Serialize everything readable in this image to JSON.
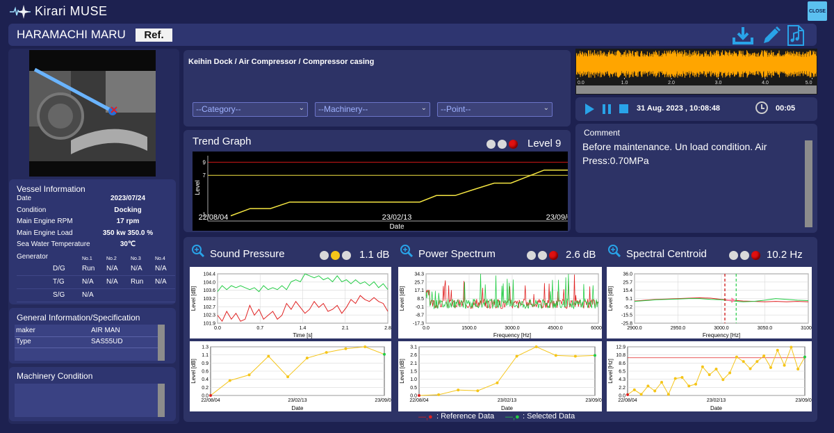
{
  "app": {
    "title": "Kirari MUSE",
    "close_label": "CLOSE"
  },
  "header": {
    "vessel_name": "HARAMACHI MARU",
    "ref_label": "Ref."
  },
  "breadcrumb": "Keihin Dock / Air Compressor / Compressor casing",
  "dropdowns": {
    "category": "--Category--",
    "machinery": "--Machinery--",
    "point": "--Point--"
  },
  "waveform": {
    "ticks": [
      "0.0",
      "1.0",
      "2.0",
      "3.0",
      "4.0",
      "5.0"
    ]
  },
  "player": {
    "datetime": "31 Aug. 2023 , 10:08:48",
    "duration": "00:05"
  },
  "comment": {
    "title": "Comment",
    "text": "Before maintenance. Un load condition. Air Press:0.70MPa"
  },
  "trend": {
    "title": "Trend Graph",
    "level_text": "Level 9",
    "ylabel": "Level",
    "xlabel": "Date",
    "yticks": [
      "9",
      "7",
      "1"
    ],
    "xticks": [
      "22/08/04",
      "23/02/13",
      "23/09/01"
    ]
  },
  "vessel_info": {
    "title": "Vessel Information",
    "rows": [
      {
        "label": "Date",
        "value": "2023/07/24"
      },
      {
        "label": "Condition",
        "value": "Docking"
      },
      {
        "label": "Main Engine RPM",
        "value": "17 rpm"
      },
      {
        "label": "Main Engine Load",
        "value": "350 kw  350.0 %"
      },
      {
        "label": "Sea Water Temperature",
        "value": "30℃"
      }
    ],
    "generator_label": "Generator",
    "gen_headers": [
      "No.1",
      "No.2",
      "No.3",
      "No.4"
    ],
    "gen_rows": [
      {
        "name": "D/G",
        "cells": [
          "Run",
          "N/A",
          "N/A",
          "N/A"
        ]
      },
      {
        "name": "T/G",
        "cells": [
          "N/A",
          "N/A",
          "Run",
          "N/A"
        ]
      },
      {
        "name": "S/G",
        "cells": [
          "N/A",
          "",
          "",
          ""
        ]
      }
    ]
  },
  "general_info": {
    "title": "General Information/Specification",
    "rows": [
      {
        "label": "maker",
        "value": "AIR MAN"
      },
      {
        "label": "Type",
        "value": "SAS55UD"
      }
    ]
  },
  "machinery_condition": {
    "title": "Machinery Condition"
  },
  "sound_pressure": {
    "title": "Sound Pressure",
    "value": "1.1 dB",
    "lamps": [
      "gray",
      "yellow",
      "gray"
    ],
    "top": {
      "ylabel": "Level [dB]",
      "xlabel": "Time [s]",
      "yticks": [
        "104.4",
        "104.0",
        "103.6",
        "103.2",
        "102.7",
        "102.3",
        "101.9"
      ],
      "xticks": [
        "0.0",
        "0.7",
        "1.4",
        "2.1",
        "2.8"
      ]
    },
    "bottom": {
      "ylabel": "Level [dB]",
      "xlabel": "Date",
      "yticks": [
        "1.3",
        "1.1",
        "0.9",
        "0.6",
        "0.4",
        "0.2",
        "0.0"
      ],
      "xticks": [
        "22/08/04",
        "23/02/13",
        "23/09/01"
      ]
    }
  },
  "power_spectrum": {
    "title": "Power Spectrum",
    "value": "2.6 dB",
    "lamps": [
      "gray",
      "gray",
      "red"
    ],
    "top": {
      "ylabel": "Level [dB]",
      "xlabel": "Frequency [Hz]",
      "yticks": [
        "34.3",
        "25.7",
        "17.1",
        "8.5",
        "-0.1",
        "-8.7",
        "-17.3"
      ],
      "xticks": [
        "0.0",
        "1500.0",
        "3000.0",
        "4500.0",
        "6000.0"
      ]
    },
    "bottom": {
      "ylabel": "Level [dB]",
      "xlabel": "Date",
      "yticks": [
        "3.1",
        "2.6",
        "2.1",
        "1.5",
        "1.0",
        "0.5",
        "0.0"
      ],
      "xticks": [
        "22/08/04",
        "23/02/13",
        "23/09/01"
      ]
    }
  },
  "spectral_centroid": {
    "title": "Spectral Centroid",
    "value": "10.2 Hz",
    "lamps": [
      "gray",
      "gray",
      "red"
    ],
    "top": {
      "ylabel": "Level [dB]",
      "xlabel": "Frequency [Hz]",
      "yticks": [
        "36.0",
        "25.7",
        "15.4",
        "5.1",
        "-5.2",
        "-15.5",
        "-25.8"
      ],
      "xticks": [
        "2900.0",
        "2950.0",
        "3000.0",
        "3050.0",
        "3100.0"
      ]
    },
    "bottom": {
      "ylabel": "Level [Hz]",
      "xlabel": "Date",
      "yticks": [
        "12.9",
        "10.8",
        "8.6",
        "6.5",
        "4.3",
        "2.2",
        "0.0"
      ],
      "xticks": [
        "22/08/04",
        "23/02/13",
        "23/09/01"
      ]
    }
  },
  "legend": {
    "reference": ": Reference Data",
    "selected": ": Selected Data"
  },
  "colors": {
    "bg": "#1d2150",
    "panel": "#2d3366",
    "accent": "#29a3e8",
    "trend": "#f5e642",
    "reference": "#e02020",
    "selected": "#22cc44",
    "wave": "#ffa500"
  },
  "chart_data": [
    {
      "type": "line",
      "title": "Trend Graph",
      "xlabel": "Date",
      "ylabel": "Level",
      "y_ticks": [
        1,
        7,
        9
      ],
      "ylim": [
        0,
        10
      ],
      "x_tick_labels": [
        "22/08/04",
        "23/02/13",
        "23/09/01"
      ],
      "series": [
        {
          "values": [
            1,
            2,
            2,
            3,
            3,
            3,
            4,
            5,
            5,
            6,
            7,
            8,
            8,
            9,
            9
          ]
        }
      ]
    },
    {
      "type": "line",
      "title": "Sound Pressure",
      "xlabel": "Time [s]",
      "ylabel": "Level [dB]",
      "ylim": [
        101.9,
        104.4
      ],
      "xlim": [
        0.0,
        2.8
      ],
      "series": [
        {
          "values": [
            103.5,
            103.8,
            103.6,
            103.8,
            103.7,
            103.8,
            103.7,
            103.6,
            103.7,
            103.5,
            103.8,
            103.6,
            103.7,
            103.6,
            103.8,
            103.6,
            104.0,
            104.1,
            104.0,
            104.4,
            104.3,
            104.2,
            104.3,
            104.1,
            104.2,
            104.0,
            104.3,
            104.0,
            104.1,
            103.9,
            104.1,
            103.9,
            104.0,
            103.8,
            104.0,
            103.7,
            103.9,
            103.6
          ]
        },
        {
          "values": [
            102.3,
            102.0,
            102.5,
            102.1,
            102.4,
            102.0,
            102.1,
            102.8,
            102.3,
            102.6,
            102.1,
            102.3,
            102.5,
            102.1,
            102.3,
            102.9,
            102.6,
            103.0,
            102.7,
            102.4,
            102.6,
            103.0,
            102.7,
            102.9,
            102.5,
            102.6,
            102.8,
            102.4,
            102.7,
            103.1,
            102.9,
            103.3,
            103.1,
            103.0,
            103.2,
            103.0,
            102.9,
            102.5
          ]
        }
      ]
    },
    {
      "type": "line",
      "title": "Sound Pressure trend",
      "xlabel": "Date",
      "ylabel": "Level [dB]",
      "ylim": [
        0.0,
        1.3
      ],
      "series": [
        {
          "values": [
            0.0,
            0.4,
            0.55,
            1.05,
            0.5,
            1.0,
            1.15,
            1.25,
            1.3,
            1.1
          ]
        }
      ]
    },
    {
      "type": "line",
      "title": "Power Spectrum",
      "xlabel": "Frequency [Hz]",
      "ylabel": "Level [dB]",
      "ylim": [
        -17.3,
        34.3
      ],
      "xlim": [
        0,
        6000
      ]
    },
    {
      "type": "line",
      "title": "Power Spectrum trend",
      "xlabel": "Date",
      "ylabel": "Level [dB]",
      "ylim": [
        0.0,
        3.1
      ],
      "series": [
        {
          "values": [
            0.0,
            0.05,
            0.35,
            0.3,
            0.8,
            2.5,
            3.1,
            2.55,
            2.5,
            2.55
          ]
        }
      ]
    },
    {
      "type": "line",
      "title": "Spectral Centroid",
      "xlabel": "Frequency [Hz]",
      "ylabel": "Level [dB]",
      "ylim": [
        -25.8,
        36.0
      ],
      "xlim": [
        2880,
        3110
      ],
      "series": [
        {
          "values": [
            2.0,
            3.0,
            4.0,
            4.5,
            5.0,
            5.5,
            6.0,
            5.5,
            4.0,
            3.0,
            2.0,
            1.5,
            1.0,
            1.5,
            1.0,
            1.5,
            1.0
          ]
        },
        {
          "values": [
            1.5,
            2.5,
            3.5,
            4.0,
            4.5,
            5.0,
            5.0,
            4.0,
            3.5,
            2.0,
            1.0,
            1.5,
            3.0,
            5.0,
            4.0,
            3.0,
            2.5
          ]
        }
      ]
    },
    {
      "type": "line",
      "title": "Spectral Centroid trend",
      "xlabel": "Date",
      "ylabel": "Level [Hz]",
      "ylim": [
        0.0,
        12.9
      ],
      "series": [
        {
          "values": [
            0.2,
            1.5,
            0.3,
            2.5,
            1.2,
            3.5,
            0.3,
            4.5,
            4.8,
            2.5,
            3.0,
            7.6,
            5.5,
            7.0,
            4.2,
            6.0,
            10.2,
            9.0,
            7.1,
            9.0,
            10.5,
            7.4,
            12.0,
            8.0,
            12.8,
            7.0,
            10.2
          ]
        }
      ]
    }
  ]
}
